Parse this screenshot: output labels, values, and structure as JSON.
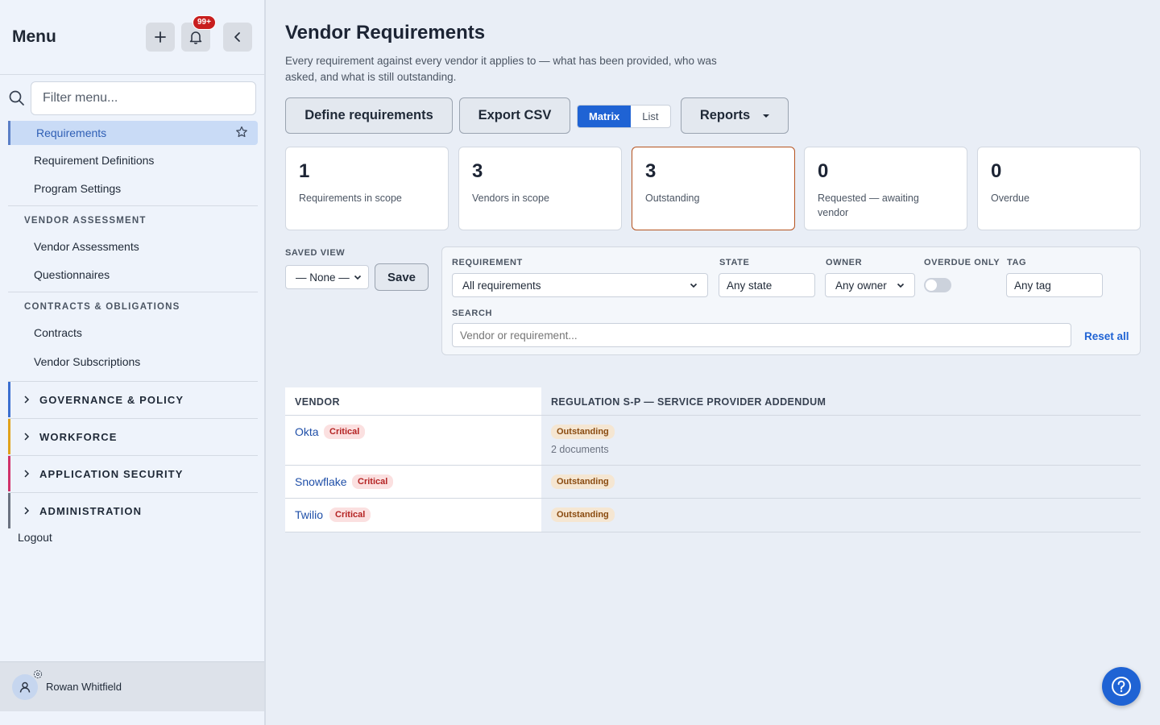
{
  "sidebar": {
    "title": "Menu",
    "notification_count": "99+",
    "filter_placeholder": "Filter menu...",
    "active_item": "Requirements",
    "items_top": [
      "Requirement Definitions",
      "Program Settings"
    ],
    "section_vendor": "VENDOR ASSESSMENT",
    "items_vendor": [
      "Vendor Assessments",
      "Questionnaires"
    ],
    "section_contracts": "CONTRACTS & OBLIGATIONS",
    "items_contracts": [
      "Contracts",
      "Vendor Subscriptions"
    ],
    "groups": [
      {
        "label": "GOVERNANCE & POLICY",
        "color": "#3b6fd0"
      },
      {
        "label": "WORKFORCE",
        "color": "#e0a21c"
      },
      {
        "label": "APPLICATION SECURITY",
        "color": "#d0336b"
      },
      {
        "label": "ADMINISTRATION",
        "color": "#6b7280"
      }
    ],
    "logout": "Logout",
    "user_name": "Rowan Whitfield"
  },
  "main": {
    "title": "Vendor Requirements",
    "description": "Every requirement against every vendor it applies to — what has been provided, who was asked, and what is still outstanding.",
    "buttons": {
      "define": "Define requirements",
      "export": "Export CSV",
      "view_matrix": "Matrix",
      "view_list": "List",
      "reports": "Reports"
    },
    "stats": [
      {
        "value": "1",
        "label": "Requirements in scope"
      },
      {
        "value": "3",
        "label": "Vendors in scope"
      },
      {
        "value": "3",
        "label": "Outstanding"
      },
      {
        "value": "0",
        "label": "Requested — awaiting vendor"
      },
      {
        "value": "0",
        "label": "Overdue"
      }
    ],
    "saved_view": {
      "label": "SAVED VIEW",
      "value": "— None —",
      "save": "Save"
    },
    "filters": {
      "requirement_label": "REQUIREMENT",
      "requirement_value": "All requirements",
      "state_label": "STATE",
      "state_value": "Any state",
      "owner_label": "OWNER",
      "owner_value": "Any owner",
      "overdue_label": "OVERDUE ONLY",
      "overdue_on": false,
      "tag_label": "TAG",
      "tag_value": "Any tag",
      "search_label": "SEARCH",
      "search_placeholder": "Vendor or requirement...",
      "reset": "Reset all"
    },
    "table": {
      "col_vendor": "VENDOR",
      "col_requirement": "REGULATION S-P — SERVICE PROVIDER ADDENDUM",
      "rows": [
        {
          "vendor": "Okta",
          "tier": "Critical",
          "status": "Outstanding",
          "docs": "2 documents"
        },
        {
          "vendor": "Snowflake",
          "tier": "Critical",
          "status": "Outstanding"
        },
        {
          "vendor": "Twilio",
          "tier": "Critical",
          "status": "Outstanding"
        }
      ]
    }
  }
}
